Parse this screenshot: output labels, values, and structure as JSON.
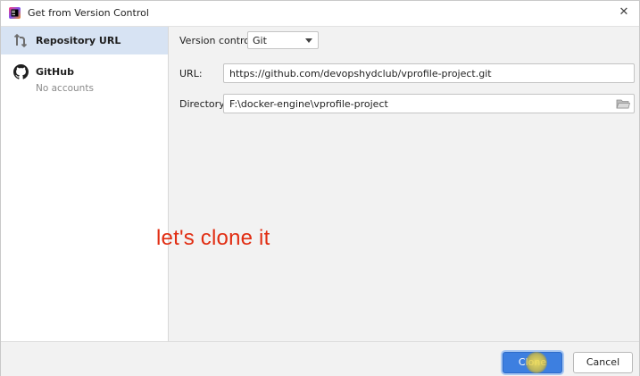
{
  "window": {
    "title": "Get from Version Control",
    "close_glyph": "✕",
    "app_icon": "intellij-idea-icon"
  },
  "sidebar": {
    "items": [
      {
        "label": "Repository URL",
        "icon": "vcs-branch-icon",
        "selected": true
      },
      {
        "label": "GitHub",
        "sublabel": "No accounts",
        "icon": "github-icon",
        "selected": false
      }
    ]
  },
  "form": {
    "version_control_label": "Version control:",
    "version_control_value": "Git",
    "url_label": "URL:",
    "url_value": "https://github.com/devopshydclub/vprofile-project.git",
    "directory_label": "Directory:",
    "directory_value": "F:\\docker-engine\\vprofile-project",
    "folder_icon": "folder-browse-icon"
  },
  "annotation": {
    "text": "let's clone it",
    "color": "#e12d12"
  },
  "footer": {
    "clone_label": "Clone",
    "cancel_label": "Cancel"
  },
  "colors": {
    "accent": "#3d7fe0",
    "selection": "#d7e3f3"
  }
}
